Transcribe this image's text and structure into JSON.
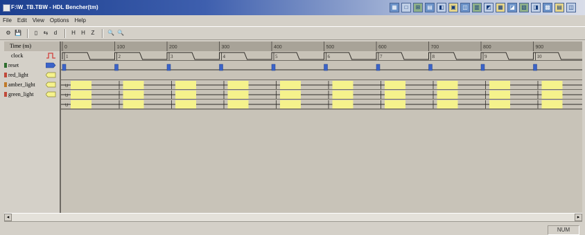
{
  "window": {
    "title": "F:\\W_TB.TBW - HDL Bencher(tm)"
  },
  "menu": [
    "File",
    "Edit",
    "View",
    "Options",
    "Help"
  ],
  "toolbar": {
    "labels": [
      "⚙",
      "💾",
      "▯",
      "⇆",
      "d",
      "H",
      "H",
      "Z",
      "🔍",
      "🔍"
    ]
  },
  "title_icons": [
    "▦",
    "□",
    "⊞",
    "▤",
    "◧",
    "▣",
    "◫",
    "▥",
    "◩",
    "▦",
    "◪",
    "▧",
    "◨",
    "▩",
    "▤",
    "◫"
  ],
  "timeline": {
    "header_label": "Time (ns)",
    "ticks": [
      "0",
      "100",
      "200",
      "300",
      "400",
      "500",
      "600",
      "700",
      "800",
      "900"
    ]
  },
  "signals": [
    {
      "name": "clock",
      "type": "clock",
      "color": "#d0403c"
    },
    {
      "name": "reset",
      "type": "input",
      "color": "#2f6f2f"
    },
    {
      "name": "red_light",
      "type": "output",
      "color": "#c04a3a"
    },
    {
      "name": "amber_light",
      "type": "output",
      "color": "#c07a2a"
    },
    {
      "name": "green_light",
      "type": "output",
      "color": "#c04a3a"
    }
  ],
  "clock_edges": [
    "1",
    "2",
    "3",
    "4",
    "5",
    "6",
    "7",
    "8",
    "9",
    "10"
  ],
  "output_value_label": "U",
  "colors": {
    "waveform_bg": "#c8c3b8",
    "undefined_fill": "#f5f28c",
    "reset_marker": "#3b63c8"
  },
  "status": {
    "right": "NUM"
  }
}
